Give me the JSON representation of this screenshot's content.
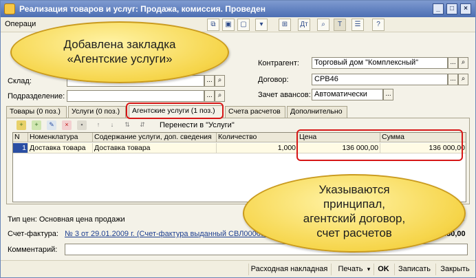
{
  "window": {
    "title": "Реализация товаров и услуг: Продажа, комиссия. Проведен",
    "controls": {
      "minimize": "_",
      "maximize": "□",
      "close": "×"
    }
  },
  "toolbar": {
    "operations_label": "Операци"
  },
  "callouts": {
    "tab_note": [
      "Добавлена закладка",
      "«Агентские услуги»"
    ],
    "principal_note": [
      "Указываются",
      "принципал,",
      "агентский договор,",
      "счет расчетов"
    ]
  },
  "form": {
    "warehouse_label": "Склад:",
    "department_label": "Подразделение:",
    "counterparty_label": "Контрагент:",
    "counterparty_value": "Торговый дом \"Комплексный\"",
    "contract_label": "Договор:",
    "contract_value": "СРВ46",
    "advance_label": "Зачет авансов:",
    "advance_value": "Автоматически",
    "select_button": "...",
    "clear_button": "×"
  },
  "tabs": [
    {
      "label": "Товары (0 поз.)"
    },
    {
      "label": "Услуги (0 поз.)"
    },
    {
      "label": "Агентские услуги (1 поз.)"
    },
    {
      "label": "Счета расчетов"
    },
    {
      "label": "Дополнительно"
    }
  ],
  "agent_services": {
    "transfer_label": "Перенести в \"Услуги\"",
    "columns": [
      "N",
      "Номенклатура",
      "Содержание услуги, доп. сведения",
      "Количество",
      "Цена",
      "Сумма"
    ],
    "rows": [
      {
        "n": "1",
        "item": "Доставка товара",
        "content": "Доставка товара",
        "quantity": "1,000",
        "price": "136 000,00",
        "sum": "136 000,00"
      }
    ]
  },
  "bottom": {
    "price_type": "Тип цен: Основная цена продажи",
    "invoice_label": "Счет-фактура:",
    "invoice_link": "№ 3 от 29.01.2009 г. (Счет-фактура выданный СВЛ0000000",
    "total_right_1": "00",
    "total_right_2": "480,00",
    "comment_label": "Комментарий:"
  },
  "footer": {
    "waybill_button": "Расходная накладная",
    "print_button": "Печать",
    "ok_button": "OK",
    "save_button": "Записать",
    "close_button": "Закрыть"
  },
  "colors": {
    "highlight": "#d61616",
    "callout": "#f6d54a",
    "row_selected": "#2a4ea3"
  }
}
